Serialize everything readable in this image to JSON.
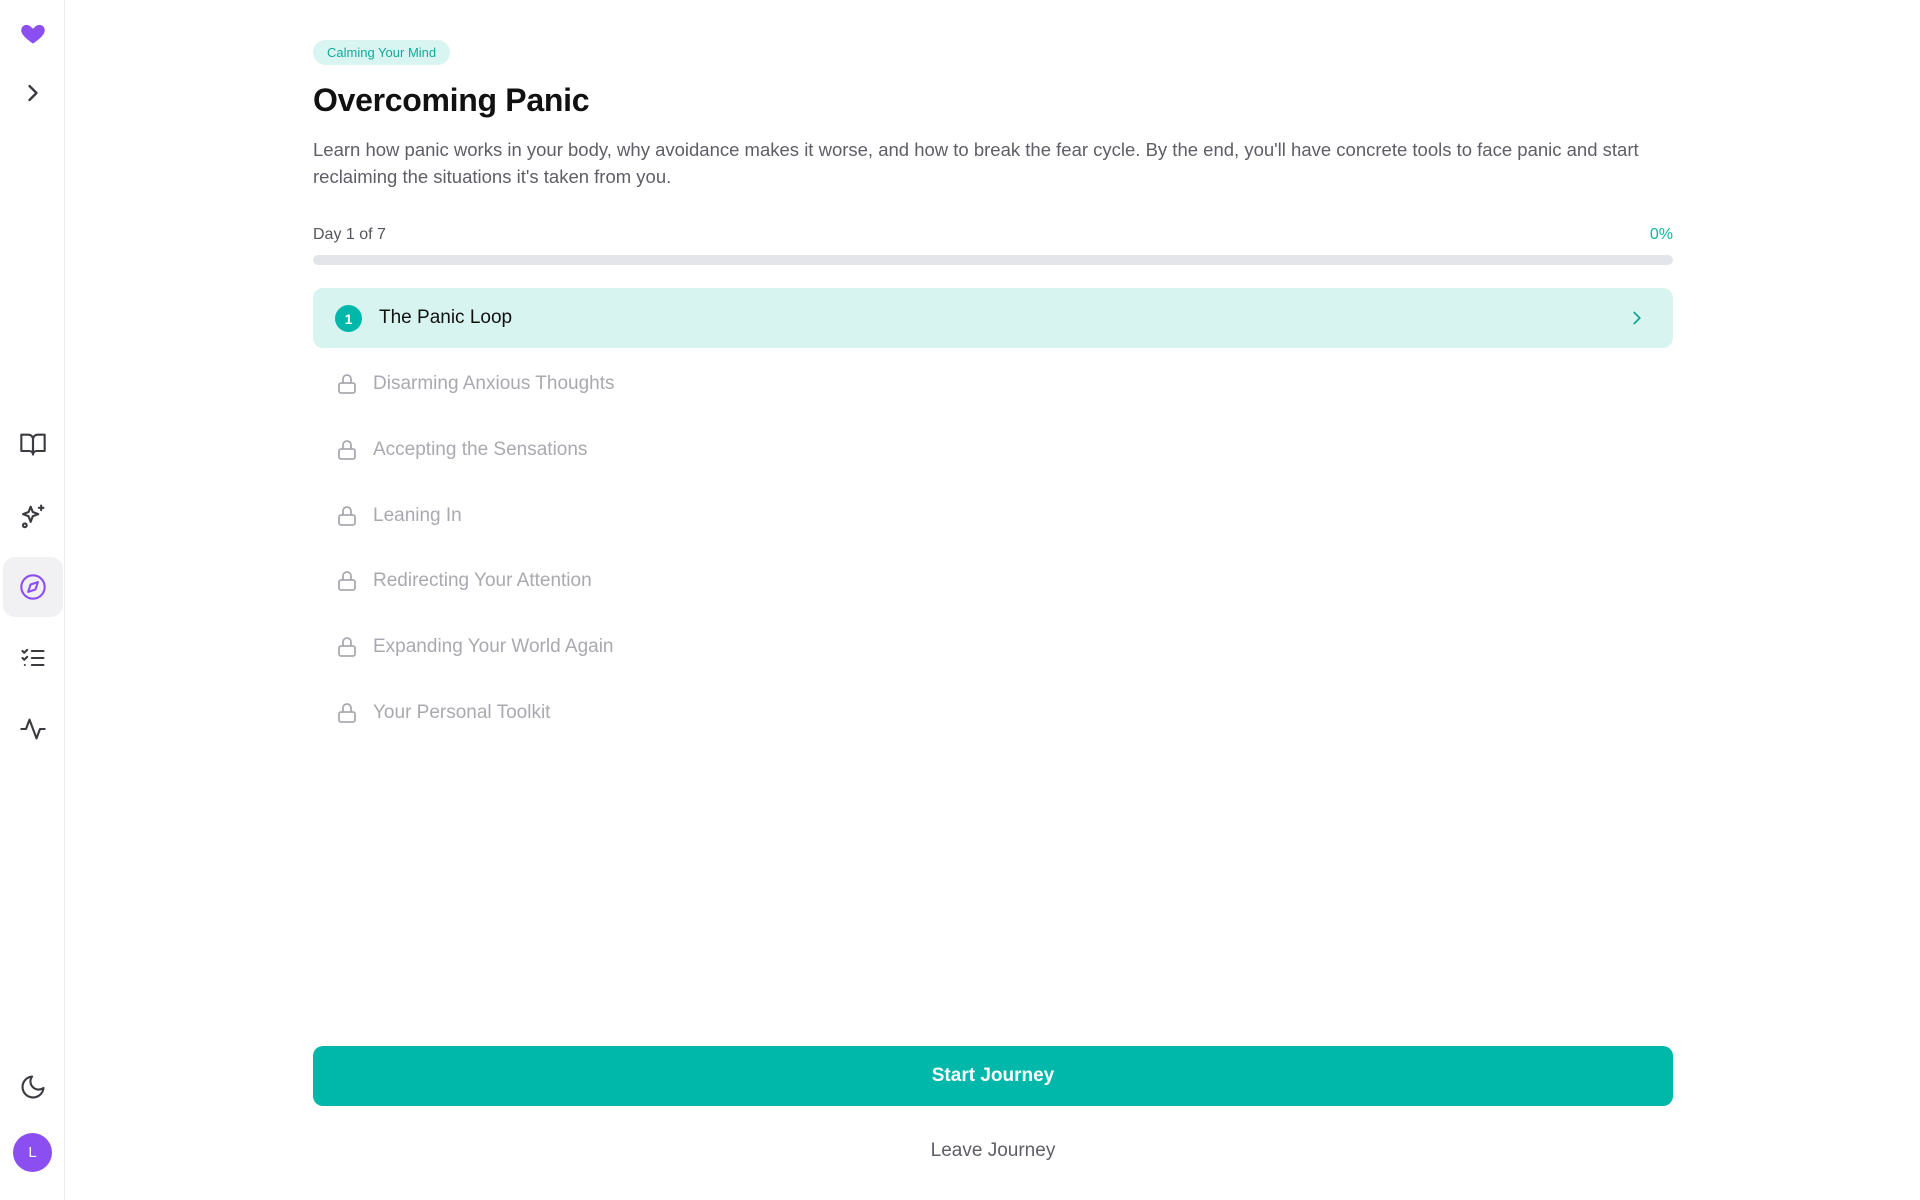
{
  "sidebar": {
    "logo_icon": "heart-icon",
    "brand_color": "#8b4ff1",
    "expand_icon": "chevron-right-icon",
    "nav_items": [
      {
        "icon": "book-open-icon"
      },
      {
        "icon": "sparkles-icon"
      },
      {
        "icon": "compass-icon",
        "active": true
      },
      {
        "icon": "checklist-icon"
      },
      {
        "icon": "activity-icon"
      }
    ],
    "theme_icon": "moon-icon",
    "avatar_initial": "L"
  },
  "journey": {
    "category": "Calming Your Mind",
    "title": "Overcoming Panic",
    "description": "Learn how panic works in your body, why avoidance makes it worse, and how to break the fear cycle. By the end, you'll have concrete tools to face panic and start reclaiming the situations it's taken from you.",
    "progress": {
      "label": "Day 1 of 7",
      "percent_label": "0%",
      "percent": 0
    },
    "accent_color": "#00b8a9",
    "lessons": [
      {
        "number": "1",
        "title": "The Panic Loop",
        "status": "current"
      },
      {
        "title": "Disarming Anxious Thoughts",
        "status": "locked"
      },
      {
        "title": "Accepting the Sensations",
        "status": "locked"
      },
      {
        "title": "Leaning In",
        "status": "locked"
      },
      {
        "title": "Redirecting Your Attention",
        "status": "locked"
      },
      {
        "title": "Expanding Your World Again",
        "status": "locked"
      },
      {
        "title": "Your Personal Toolkit",
        "status": "locked"
      }
    ],
    "start_label": "Start Journey",
    "leave_label": "Leave Journey"
  }
}
